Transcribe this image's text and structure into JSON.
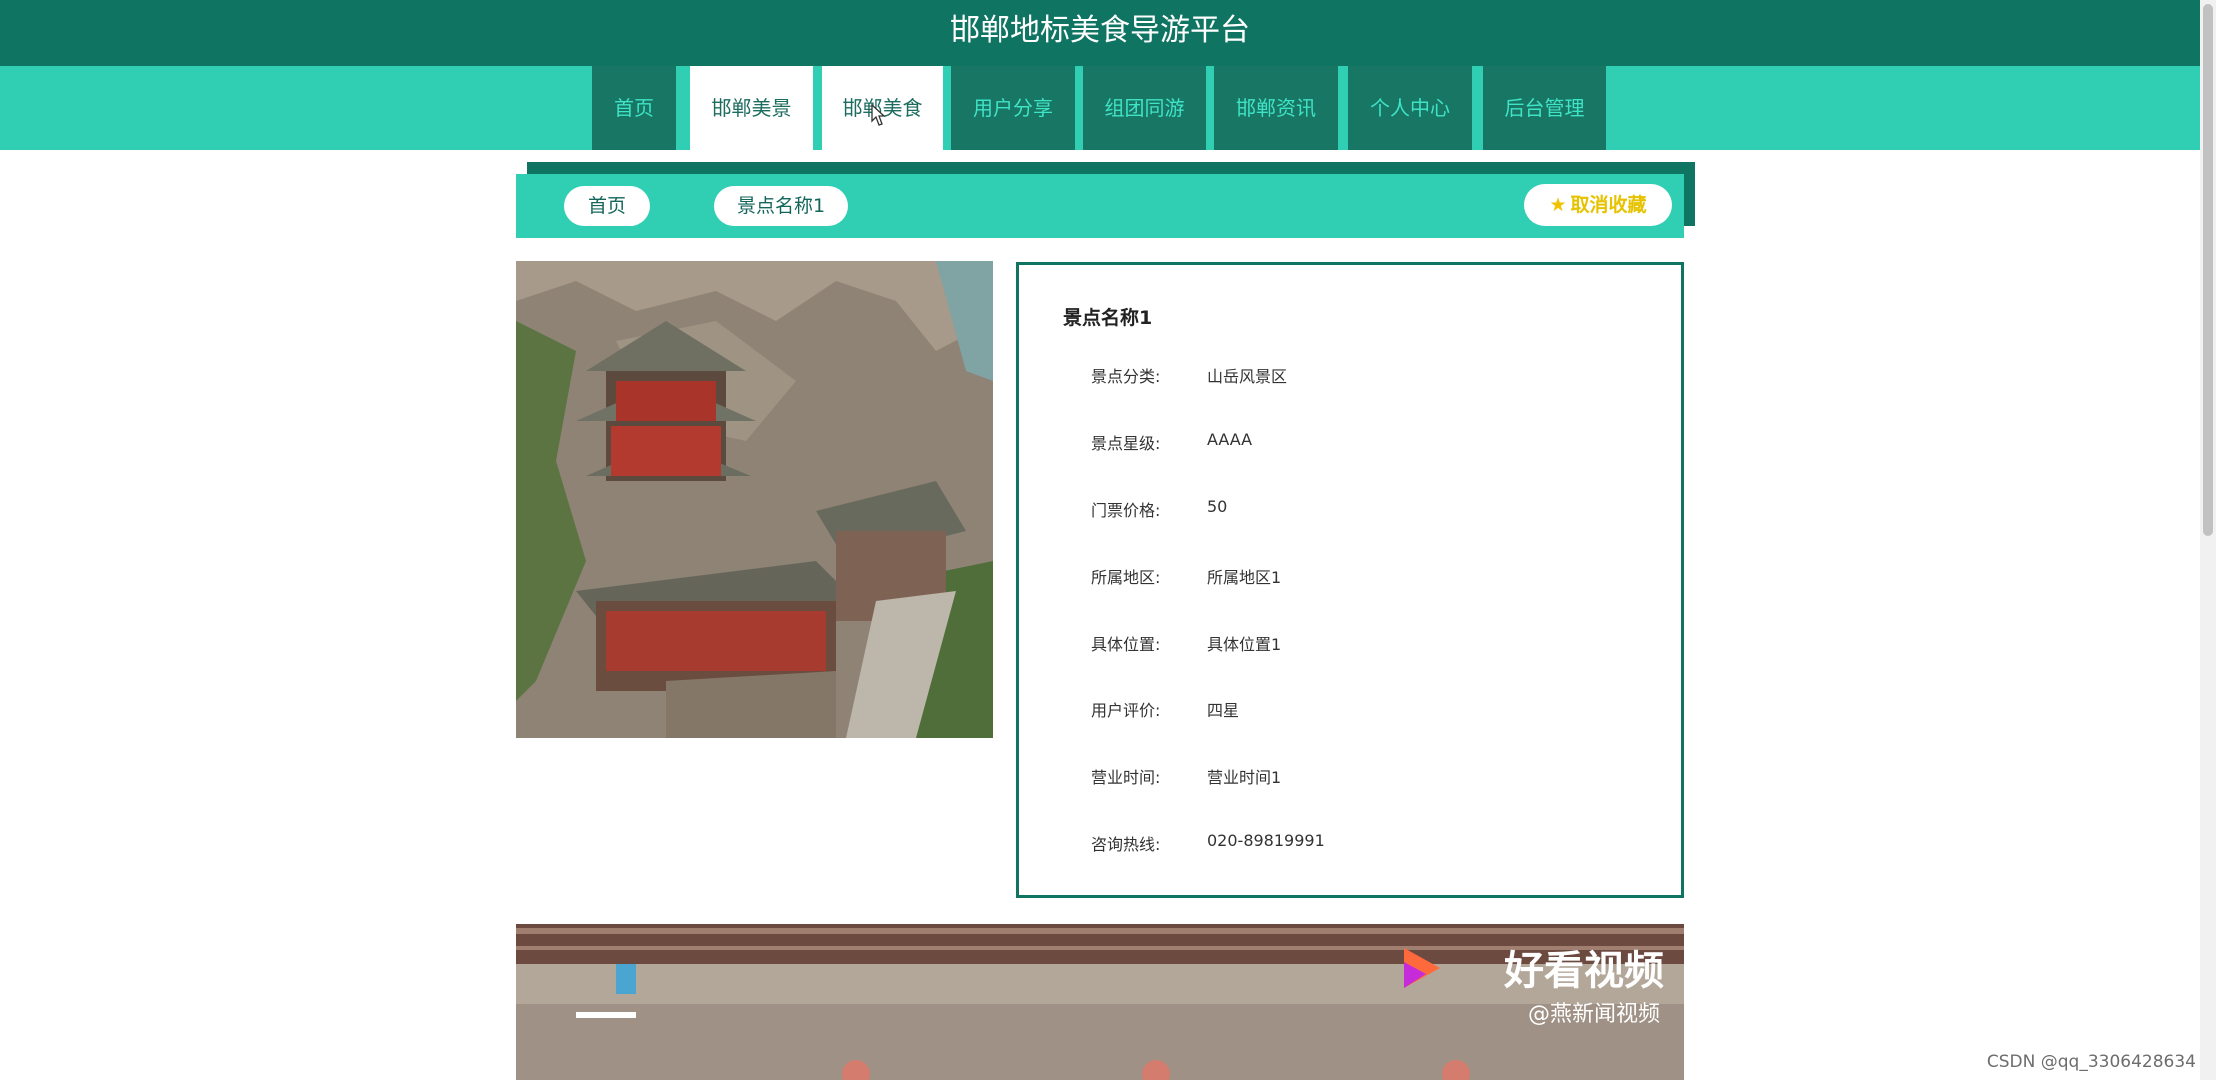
{
  "header": {
    "title": "邯郸地标美食导游平台"
  },
  "nav": {
    "items": [
      {
        "label": "首页"
      },
      {
        "label": "邯郸美景"
      },
      {
        "label": "邯郸美食"
      },
      {
        "label": "用户分享"
      },
      {
        "label": "组团同游"
      },
      {
        "label": "邯郸资讯"
      },
      {
        "label": "个人中心"
      },
      {
        "label": "后台管理"
      }
    ],
    "active_index": 1
  },
  "breadcrumb": {
    "home": "首页",
    "current": "景点名称1"
  },
  "favorite_button": {
    "label": "取消收藏",
    "icon": "star-icon"
  },
  "detail": {
    "title": "景点名称1",
    "rows": [
      {
        "label": "景点分类:",
        "value": "山岳风景区"
      },
      {
        "label": "景点星级:",
        "value": "AAAA"
      },
      {
        "label": "门票价格:",
        "value": "50"
      },
      {
        "label": "所属地区:",
        "value": "所属地区1"
      },
      {
        "label": "具体位置:",
        "value": "具体位置1"
      },
      {
        "label": "用户评价:",
        "value": "四星"
      },
      {
        "label": "营业时间:",
        "value": "营业时间1"
      },
      {
        "label": "咨询热线:",
        "value": "020-89819991"
      }
    ]
  },
  "video": {
    "brand": "好看视频",
    "source": "@燕新闻视频"
  },
  "watermark": "CSDN @qq_3306428634",
  "colors": {
    "header_bg": "#0f7462",
    "nav_bg": "#30cfb4",
    "nav_item_bg": "#187665",
    "nav_text": "#3fe3c5",
    "accent_gold": "#f2c100"
  }
}
